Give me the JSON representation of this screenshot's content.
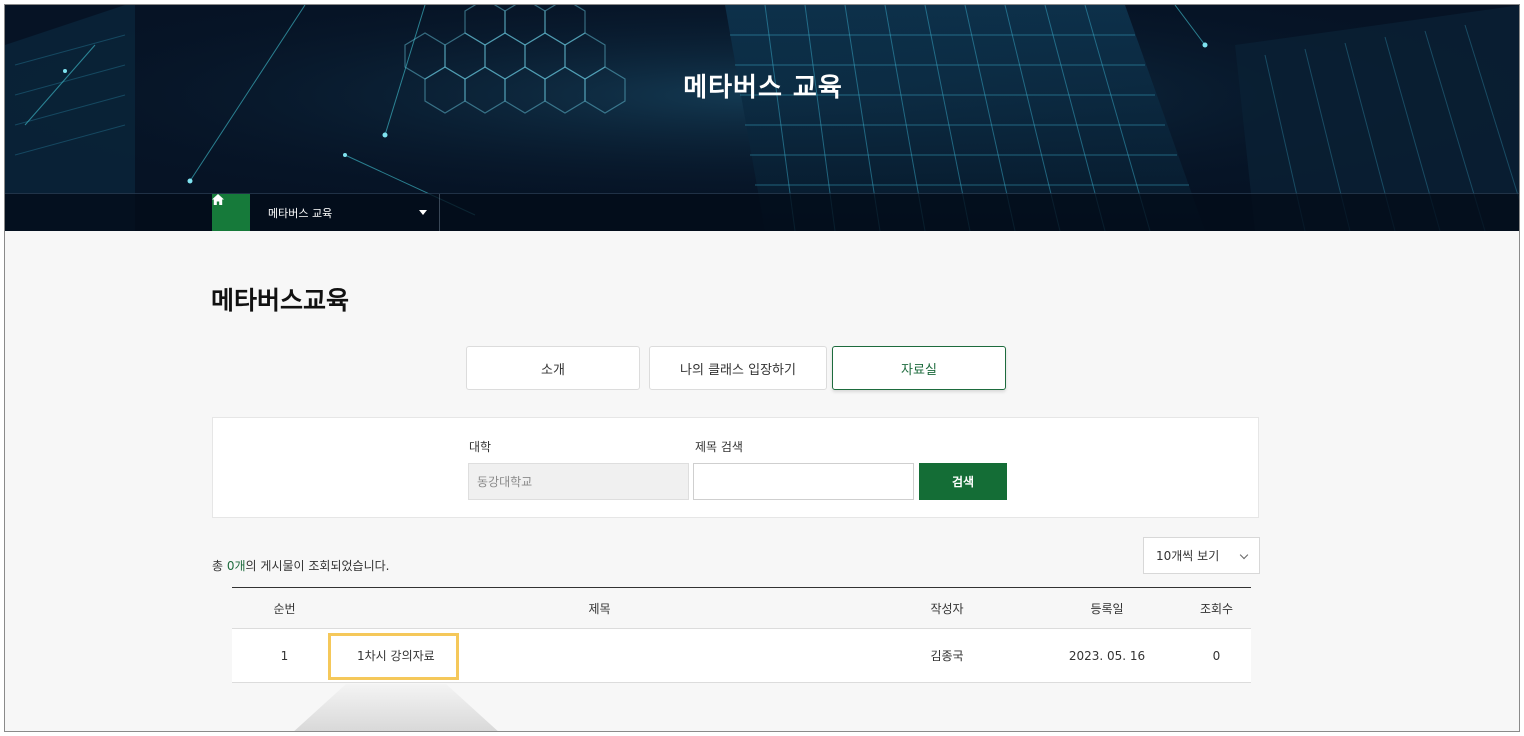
{
  "hero": {
    "title": "메타버스 교육"
  },
  "breadcrumb": {
    "menu_label": "메타버스 교육"
  },
  "page": {
    "title": "메타버스교육"
  },
  "tabs": [
    {
      "label": "소개",
      "active": false
    },
    {
      "label": "나의 클래스 입장하기",
      "active": false
    },
    {
      "label": "자료실",
      "active": true
    }
  ],
  "search": {
    "university_label": "대학",
    "university_value": "동강대학교",
    "title_label": "제목 검색",
    "title_value": "",
    "button_label": "검색"
  },
  "result": {
    "prefix": "총 ",
    "count": "0개",
    "suffix": "의 게시물이 조회되었습니다."
  },
  "per_page": {
    "selected": "10개씩 보기"
  },
  "table": {
    "headers": {
      "no": "순번",
      "title": "제목",
      "author": "작성자",
      "date": "등록일",
      "views": "조회수"
    },
    "rows": [
      {
        "no": "1",
        "title": "1차시 강의자료",
        "author": "김종국",
        "date": "2023. 05. 16",
        "views": "0"
      }
    ]
  },
  "colors": {
    "accent": "#167a3a",
    "highlight": "#f5c85a",
    "hero_bg": "#061325"
  }
}
